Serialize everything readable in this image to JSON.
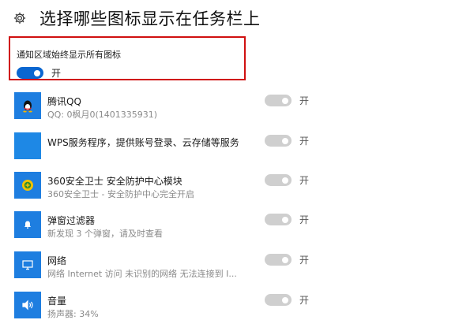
{
  "header": {
    "title": "选择哪些图标显示在任务栏上",
    "icon": "gear-icon"
  },
  "always_show": {
    "label": "通知区域始终显示所有图标",
    "toggle_text": "开",
    "state": "on",
    "accent": "#0a66d0"
  },
  "items": [
    {
      "title": "腾讯QQ",
      "subtitle": "QQ: 0枫月0(1401335931)",
      "toggle_text": "开",
      "icon": "qq-penguin-icon"
    },
    {
      "title": "WPS服务程序，提供账号登录、云存储等服务",
      "subtitle": "",
      "toggle_text": "开",
      "icon": "app-tile-icon"
    },
    {
      "title": "360安全卫士 安全防护中心模块",
      "subtitle": "360安全卫士 - 安全防护中心完全开启",
      "toggle_text": "开",
      "icon": "shield-360-icon"
    },
    {
      "title": "弹窗过滤器",
      "subtitle": "新发现 3 个弹窗，请及时查看",
      "toggle_text": "开",
      "icon": "bell-icon"
    },
    {
      "title": "网络",
      "subtitle": "网络 Internet 访问  未识别的网络 无法连接到 I...",
      "toggle_text": "开",
      "icon": "monitor-icon"
    },
    {
      "title": "音量",
      "subtitle": "扬声器: 34%",
      "toggle_text": "开",
      "icon": "speaker-icon"
    }
  ]
}
